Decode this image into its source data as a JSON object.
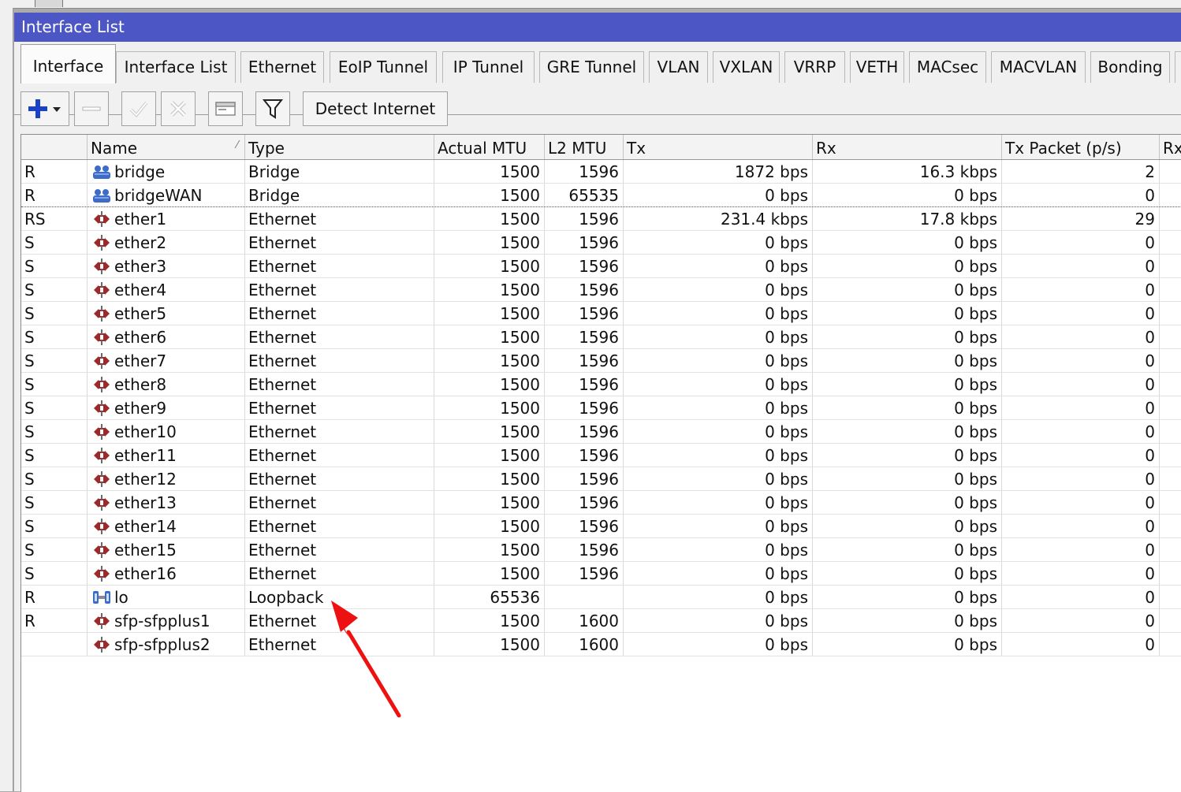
{
  "window": {
    "title": "Interface List"
  },
  "tabs": [
    {
      "label": "Interface",
      "active": true
    },
    {
      "label": "Interface List"
    },
    {
      "label": "Ethernet"
    },
    {
      "label": "EoIP Tunnel"
    },
    {
      "label": "IP Tunnel"
    },
    {
      "label": "GRE Tunnel"
    },
    {
      "label": "VLAN"
    },
    {
      "label": "VXLAN"
    },
    {
      "label": "VRRP"
    },
    {
      "label": "VETH"
    },
    {
      "label": "MACsec"
    },
    {
      "label": "MACVLAN"
    },
    {
      "label": "Bonding"
    }
  ],
  "toolbar": {
    "add_icon": "plus-icon",
    "remove_icon": "minus-icon",
    "enable_icon": "check-icon",
    "disable_icon": "x-icon",
    "comment_icon": "note-icon",
    "filter_icon": "filter-icon",
    "detect_label": "Detect Internet"
  },
  "table": {
    "columns": [
      "",
      "Name",
      "Type",
      "Actual MTU",
      "L2 MTU",
      "Tx",
      "Rx",
      "Tx Packet (p/s)",
      "Rx"
    ],
    "rows": [
      {
        "flags": "R",
        "icon": "bridge-icon",
        "name": "bridge",
        "type": "Bridge",
        "actual_mtu": "1500",
        "l2_mtu": "1596",
        "tx": "1872 bps",
        "rx": "16.3 kbps",
        "tx_packet": "2"
      },
      {
        "flags": "R",
        "icon": "bridge-icon",
        "name": "bridgeWAN",
        "type": "Bridge",
        "actual_mtu": "1500",
        "l2_mtu": "65535",
        "tx": "0 bps",
        "rx": "0 bps",
        "tx_packet": "0"
      },
      {
        "flags": "RS",
        "icon": "ethernet-icon",
        "name": "ether1",
        "type": "Ethernet",
        "actual_mtu": "1500",
        "l2_mtu": "1596",
        "tx": "231.4 kbps",
        "rx": "17.8 kbps",
        "tx_packet": "29"
      },
      {
        "flags": "S",
        "icon": "ethernet-icon",
        "name": "ether2",
        "type": "Ethernet",
        "actual_mtu": "1500",
        "l2_mtu": "1596",
        "tx": "0 bps",
        "rx": "0 bps",
        "tx_packet": "0"
      },
      {
        "flags": "S",
        "icon": "ethernet-icon",
        "name": "ether3",
        "type": "Ethernet",
        "actual_mtu": "1500",
        "l2_mtu": "1596",
        "tx": "0 bps",
        "rx": "0 bps",
        "tx_packet": "0"
      },
      {
        "flags": "S",
        "icon": "ethernet-icon",
        "name": "ether4",
        "type": "Ethernet",
        "actual_mtu": "1500",
        "l2_mtu": "1596",
        "tx": "0 bps",
        "rx": "0 bps",
        "tx_packet": "0"
      },
      {
        "flags": "S",
        "icon": "ethernet-icon",
        "name": "ether5",
        "type": "Ethernet",
        "actual_mtu": "1500",
        "l2_mtu": "1596",
        "tx": "0 bps",
        "rx": "0 bps",
        "tx_packet": "0"
      },
      {
        "flags": "S",
        "icon": "ethernet-icon",
        "name": "ether6",
        "type": "Ethernet",
        "actual_mtu": "1500",
        "l2_mtu": "1596",
        "tx": "0 bps",
        "rx": "0 bps",
        "tx_packet": "0"
      },
      {
        "flags": "S",
        "icon": "ethernet-icon",
        "name": "ether7",
        "type": "Ethernet",
        "actual_mtu": "1500",
        "l2_mtu": "1596",
        "tx": "0 bps",
        "rx": "0 bps",
        "tx_packet": "0"
      },
      {
        "flags": "S",
        "icon": "ethernet-icon",
        "name": "ether8",
        "type": "Ethernet",
        "actual_mtu": "1500",
        "l2_mtu": "1596",
        "tx": "0 bps",
        "rx": "0 bps",
        "tx_packet": "0"
      },
      {
        "flags": "S",
        "icon": "ethernet-icon",
        "name": "ether9",
        "type": "Ethernet",
        "actual_mtu": "1500",
        "l2_mtu": "1596",
        "tx": "0 bps",
        "rx": "0 bps",
        "tx_packet": "0"
      },
      {
        "flags": "S",
        "icon": "ethernet-icon",
        "name": "ether10",
        "type": "Ethernet",
        "actual_mtu": "1500",
        "l2_mtu": "1596",
        "tx": "0 bps",
        "rx": "0 bps",
        "tx_packet": "0"
      },
      {
        "flags": "S",
        "icon": "ethernet-icon",
        "name": "ether11",
        "type": "Ethernet",
        "actual_mtu": "1500",
        "l2_mtu": "1596",
        "tx": "0 bps",
        "rx": "0 bps",
        "tx_packet": "0"
      },
      {
        "flags": "S",
        "icon": "ethernet-icon",
        "name": "ether12",
        "type": "Ethernet",
        "actual_mtu": "1500",
        "l2_mtu": "1596",
        "tx": "0 bps",
        "rx": "0 bps",
        "tx_packet": "0"
      },
      {
        "flags": "S",
        "icon": "ethernet-icon",
        "name": "ether13",
        "type": "Ethernet",
        "actual_mtu": "1500",
        "l2_mtu": "1596",
        "tx": "0 bps",
        "rx": "0 bps",
        "tx_packet": "0"
      },
      {
        "flags": "S",
        "icon": "ethernet-icon",
        "name": "ether14",
        "type": "Ethernet",
        "actual_mtu": "1500",
        "l2_mtu": "1596",
        "tx": "0 bps",
        "rx": "0 bps",
        "tx_packet": "0"
      },
      {
        "flags": "S",
        "icon": "ethernet-icon",
        "name": "ether15",
        "type": "Ethernet",
        "actual_mtu": "1500",
        "l2_mtu": "1596",
        "tx": "0 bps",
        "rx": "0 bps",
        "tx_packet": "0"
      },
      {
        "flags": "S",
        "icon": "ethernet-icon",
        "name": "ether16",
        "type": "Ethernet",
        "actual_mtu": "1500",
        "l2_mtu": "1596",
        "tx": "0 bps",
        "rx": "0 bps",
        "tx_packet": "0"
      },
      {
        "flags": "R",
        "icon": "loopback-icon",
        "name": "lo",
        "type": "Loopback",
        "actual_mtu": "65536",
        "l2_mtu": "",
        "tx": "0 bps",
        "rx": "0 bps",
        "tx_packet": "0"
      },
      {
        "flags": "R",
        "icon": "ethernet-icon",
        "name": "sfp-sfpplus1",
        "type": "Ethernet",
        "actual_mtu": "1500",
        "l2_mtu": "1600",
        "tx": "0 bps",
        "rx": "0 bps",
        "tx_packet": "0"
      },
      {
        "flags": "",
        "icon": "ethernet-icon",
        "name": "sfp-sfpplus2",
        "type": "Ethernet",
        "actual_mtu": "1500",
        "l2_mtu": "1600",
        "tx": "0 bps",
        "rx": "0 bps",
        "tx_packet": "0"
      }
    ]
  },
  "annotation": {
    "icon": "red-arrow-icon",
    "color": "#ee1111"
  },
  "colors": {
    "titlebar": "#4c56c4",
    "add_icon": "#1840c8",
    "ethernet_icon": "#9c2a2a",
    "bridge_icon": "#3c6cc8"
  }
}
